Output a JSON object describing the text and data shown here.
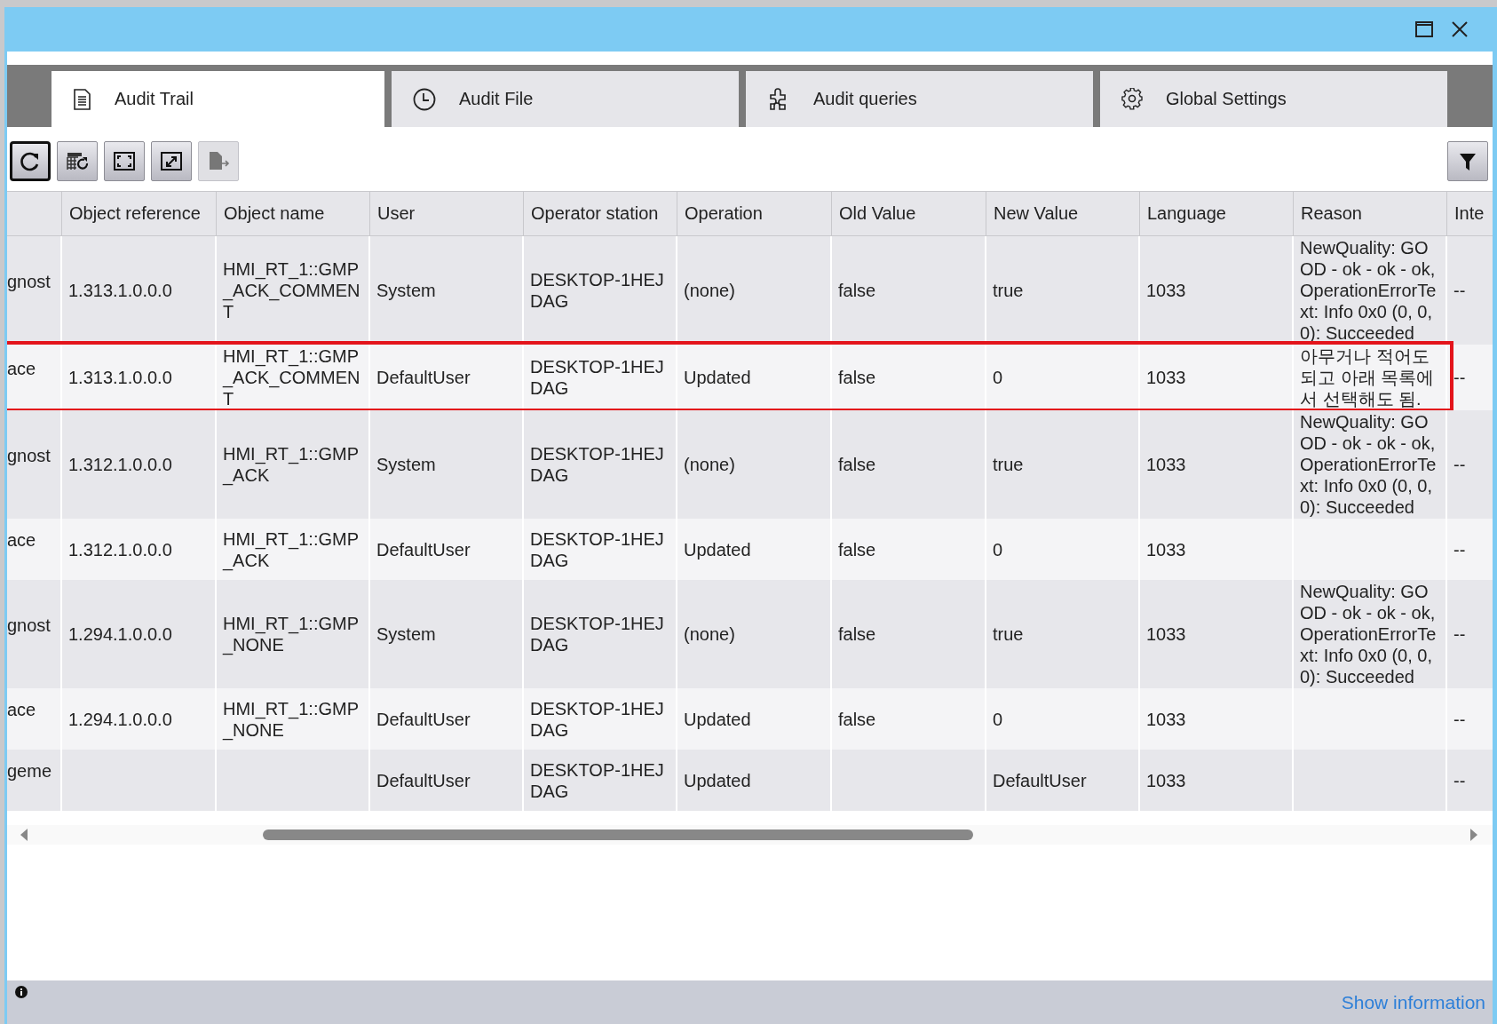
{
  "tabs": [
    {
      "label": "Audit Trail",
      "kind": "document",
      "selected": true
    },
    {
      "label": "Audit File",
      "kind": "clock",
      "selected": false
    },
    {
      "label": "Audit queries",
      "kind": "puzzle",
      "selected": false
    },
    {
      "label": "Global Settings",
      "kind": "gear",
      "selected": false
    }
  ],
  "toolbar": {
    "buttons": [
      {
        "kind": "refresh",
        "focused": true,
        "disabled": false
      },
      {
        "kind": "table-refresh",
        "focused": false,
        "disabled": false
      },
      {
        "kind": "frame",
        "focused": false,
        "disabled": false
      },
      {
        "kind": "frame-arrows",
        "focused": false,
        "disabled": false
      },
      {
        "kind": "export",
        "focused": false,
        "disabled": true
      }
    ]
  },
  "table": {
    "columns": [
      "",
      "Object reference",
      "Object name",
      "User",
      "Operator station",
      "Operation",
      "Old Value",
      "New Value",
      "Language",
      "Reason",
      "Inte"
    ],
    "rows": [
      {
        "highlighted": false,
        "cells": [
          "gnost",
          "1.313.1.0.0.0",
          "HMI_RT_1::GMP_ACK_COMMENT",
          "System",
          "DESKTOP-1HEJDAG",
          "(none)",
          "false",
          "true",
          "1033",
          "NewQuality: GOOD - ok - ok - ok, OperationErrorText: Info 0x0 (0, 0, 0): Succeeded",
          "--"
        ]
      },
      {
        "highlighted": true,
        "cells": [
          "ace",
          "1.313.1.0.0.0",
          "HMI_RT_1::GMP_ACK_COMMENT",
          "DefaultUser",
          "DESKTOP-1HEJDAG",
          "Updated",
          "false",
          "0",
          "1033",
          "아무거나 적어도 되고 아래 목록에서 선택해도 됨.",
          "--"
        ]
      },
      {
        "highlighted": false,
        "cells": [
          "gnost",
          "1.312.1.0.0.0",
          "HMI_RT_1::GMP_ACK",
          "System",
          "DESKTOP-1HEJDAG",
          "(none)",
          "false",
          "true",
          "1033",
          "NewQuality: GOOD - ok - ok - ok, OperationErrorText: Info 0x0 (0, 0, 0): Succeeded",
          "--"
        ]
      },
      {
        "highlighted": false,
        "cells": [
          "ace",
          "1.312.1.0.0.0",
          "HMI_RT_1::GMP_ACK",
          "DefaultUser",
          "DESKTOP-1HEJDAG",
          "Updated",
          "false",
          "0",
          "1033",
          null,
          "--"
        ]
      },
      {
        "highlighted": false,
        "cells": [
          "gnost",
          "1.294.1.0.0.0",
          "HMI_RT_1::GMP_NONE",
          "System",
          "DESKTOP-1HEJDAG",
          "(none)",
          "false",
          "true",
          "1033",
          "NewQuality: GOOD - ok - ok - ok, OperationErrorText: Info 0x0 (0, 0, 0): Succeeded",
          "--"
        ]
      },
      {
        "highlighted": false,
        "cells": [
          "ace",
          "1.294.1.0.0.0",
          "HMI_RT_1::GMP_NONE",
          "DefaultUser",
          "DESKTOP-1HEJDAG",
          "Updated",
          "false",
          "0",
          "1033",
          null,
          "--"
        ]
      },
      {
        "highlighted": false,
        "cells": [
          "geme",
          null,
          null,
          "DefaultUser",
          "DESKTOP-1HEJDAG",
          "Updated",
          null,
          "DefaultUser",
          "1033",
          null,
          "--"
        ]
      }
    ]
  },
  "status_bar": {
    "link": "Show information"
  }
}
